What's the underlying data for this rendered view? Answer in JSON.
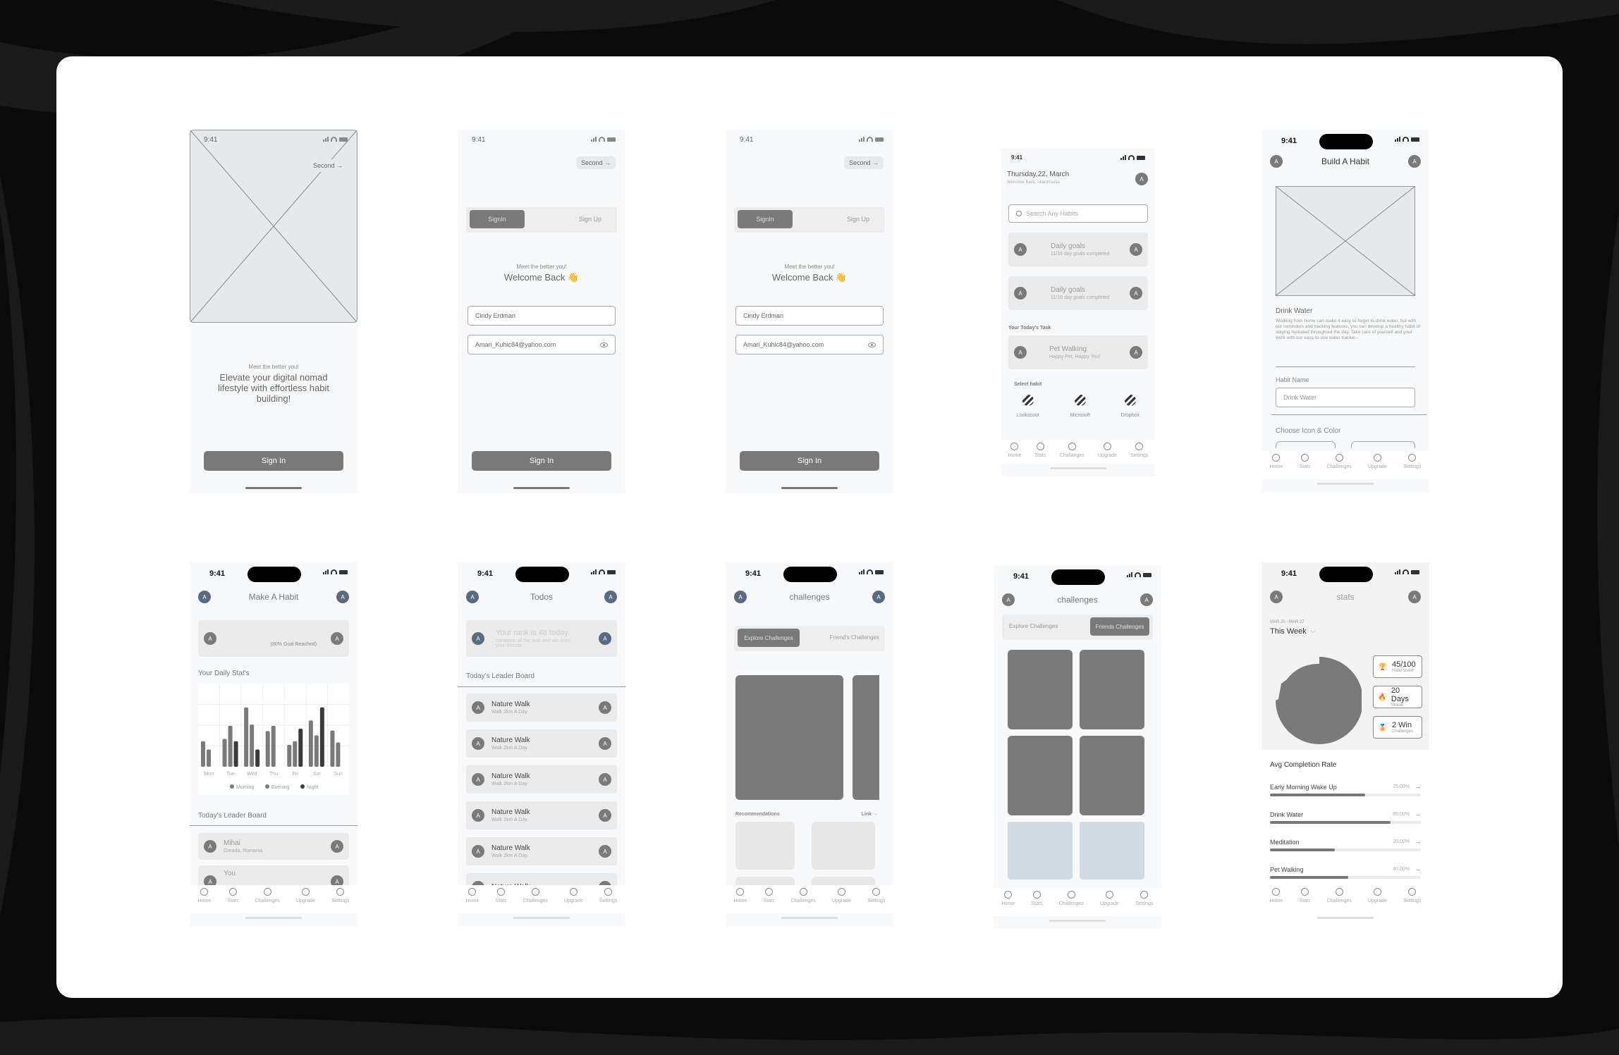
{
  "colors": {
    "background": "#0b0b0b",
    "canvas": "#ffffff",
    "screen": "#f8f9fa",
    "primary_button": "#7a7a7a",
    "avatar_blue": "#5a6a80",
    "placeholder_tile": "#d2dbe3"
  },
  "status_time": "9:41",
  "tabbar": {
    "items": [
      "Home",
      "Stats",
      "Challenges",
      "Upgrade",
      "Settings"
    ],
    "home_items_variant": [
      "Home",
      "Stats",
      "Challanges",
      "Upgrade",
      "Settings"
    ]
  },
  "screens": {
    "onboarding": {
      "second_label": "Second →",
      "tagline": "Meet the better you!",
      "headline": "Elevate your digital nomad lifestyle with effortless habit building!",
      "sign_in": "Sign In"
    },
    "signin_a": {
      "second_label": "Second →",
      "tab_signin": "SignIn",
      "tab_signup": "Sign Up",
      "tagline": "Meet the better you!",
      "welcome": "Welcome Back 👋",
      "name_value": "Cindy Erdman",
      "email_value": "Amari_Kuhic84@yahoo.com",
      "sign_in": "Sign In"
    },
    "signin_b": {
      "second_label": "Second →",
      "tab_signin": "SignIn",
      "tab_signup": "Sign Up",
      "tagline": "Meet the better you!",
      "welcome": "Welcome Back 👋",
      "name_value": "Cindy Erdman",
      "email_value": "Amari_Kuhic84@yahoo.com",
      "sign_in": "Sign In"
    },
    "home": {
      "date": "Thursday,22, March",
      "welcome": "Welcome Back, ukaromania.",
      "search_placeholder": "Search Any Habits",
      "goals": [
        {
          "title": "Daily goals",
          "sub": "11/16 day goals completed"
        },
        {
          "title": "Daily goals",
          "sub": "11/16 day goals completed"
        }
      ],
      "task_label": "Your Today's Task",
      "task": {
        "title": "Pet Walking",
        "sub": "Happy Pet, Happy You!"
      },
      "select_label": "Select habit",
      "habits": [
        "Lookscout",
        "Microsoft",
        "Dropbox"
      ]
    },
    "build_habit": {
      "title": "Build A Habit",
      "habit_title": "Drink Water",
      "description": "Working from home can make it easy to forget to drink water, but with our reminders and tracking features, you can develop a healthy habit of staying hydrated throughout the day. Take care of yourself and your work with our easy-to-use water tracker.-",
      "name_label": "Habit Name",
      "name_value": "Drink Water",
      "icon_label": "Choose Icon & Color"
    },
    "make_habit": {
      "title": "Make A Habit",
      "goal_text": "(80% Goal Reached)",
      "stats_label": "Your Daily Stat's",
      "leader_label": "Today's Leader Board",
      "leaders": [
        {
          "name": "Mihai",
          "sub": "Oreada, Romania"
        },
        {
          "name": "You",
          "sub": ""
        }
      ]
    },
    "todos": {
      "title": "Todos",
      "rank_title": "Your rank is 48 today.",
      "rank_sub": "complete all the task and win from your friends.",
      "leader_label": "Today's Leader Board",
      "items": [
        {
          "title": "Nature Walk",
          "sub": "Walk 2km A Day."
        },
        {
          "title": "Nature Walk",
          "sub": "Walk 2km A Day."
        },
        {
          "title": "Nature Walk",
          "sub": "Walk 2km A Day."
        },
        {
          "title": "Nature Walk",
          "sub": "Walk 2km A Day."
        },
        {
          "title": "Nature Walk",
          "sub": "Walk 2km A Day."
        },
        {
          "title": "Nature Walk",
          "sub": ""
        }
      ]
    },
    "challenges_explore": {
      "title": "challenges",
      "tab_active": "Explore Challenges",
      "tab_inactive": "Friend's Challenges",
      "rec_label": "Recommendations",
      "link": "Link →"
    },
    "challenges_friends": {
      "title": "challenges",
      "tab_inactive": "Explore Challenges",
      "tab_active": "Friends Challenges"
    },
    "stats": {
      "title": "stats",
      "range": "MAR 20 - MAR 27",
      "period": "This Week",
      "cards": [
        {
          "icon": "trophy-icon",
          "glyph": "🏆",
          "value": "45/100",
          "label": "Habit score"
        },
        {
          "icon": "fire-icon",
          "glyph": "🔥",
          "value": "20 Days",
          "label": "Streak"
        },
        {
          "icon": "medal-icon",
          "glyph": "🏅",
          "value": "2 Win",
          "label": "Challenges"
        }
      ],
      "avg_label": "Avg Completion Rate",
      "rates": [
        {
          "name": "Early Morning Wake Up",
          "pct_text": "25.00%",
          "fill": 0.63
        },
        {
          "name": "Drink Water",
          "pct_text": "85.00%",
          "fill": 0.8
        },
        {
          "name": "Meditation",
          "pct_text": "20.00%",
          "fill": 0.43
        },
        {
          "name": "Pet Walking",
          "pct_text": "40.00%",
          "fill": 0.52
        }
      ]
    }
  },
  "chart_data": {
    "type": "bar",
    "title": "Your Daily Stat's",
    "categories": [
      "Mon",
      "Tue",
      "Wed",
      "Thu",
      "Fri",
      "Sat",
      "Sun"
    ],
    "series": [
      {
        "name": "Morning",
        "color": "#7a7a7a",
        "values": [
          43,
          47,
          100,
          60,
          37,
          78,
          61
        ]
      },
      {
        "name": "Evening",
        "color": "#7a7a7a",
        "values": [
          29,
          69,
          71,
          69,
          43,
          53,
          41
        ]
      },
      {
        "name": "Night",
        "color": "#3a3a3a",
        "values": [
          null,
          43,
          29,
          null,
          64,
          100,
          null
        ]
      }
    ],
    "ylim": [
      0,
      140
    ],
    "grid": true,
    "legend": "bottom"
  }
}
